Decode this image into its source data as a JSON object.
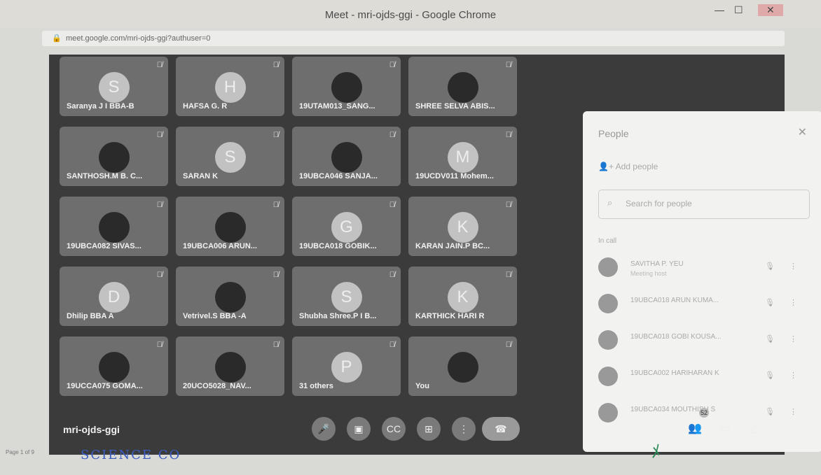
{
  "window": {
    "title": "Meet - mri-ojds-ggi - Google Chrome",
    "url": "meet.google.com/mri-ojds-ggi?authuser=0"
  },
  "tiles": [
    {
      "name": "Saranya J I BBA-B",
      "initial": "S"
    },
    {
      "name": "HAFSA G. R",
      "initial": "H"
    },
    {
      "name": "19UTAM013_SANG...",
      "initial": ""
    },
    {
      "name": "SHREE SELVA ABIS...",
      "initial": ""
    },
    {
      "name": "SANTHOSH.M B. C...",
      "initial": ""
    },
    {
      "name": "SARAN K",
      "initial": "S"
    },
    {
      "name": "19UBCA046 SANJA...",
      "initial": ""
    },
    {
      "name": "19UCDV011 Mohem...",
      "initial": "M"
    },
    {
      "name": "19UBCA082 SIVAS...",
      "initial": ""
    },
    {
      "name": "19UBCA006 ARUN...",
      "initial": ""
    },
    {
      "name": "19UBCA018 GOBIK...",
      "initial": "G"
    },
    {
      "name": "KARAN JAIN.P BC...",
      "initial": "K"
    },
    {
      "name": "Dhilip BBA A",
      "initial": "D"
    },
    {
      "name": "Vetrivel.S BBA -A",
      "initial": ""
    },
    {
      "name": "Shubha Shree.P I B...",
      "initial": "S"
    },
    {
      "name": "KARTHICK HARI R",
      "initial": "K"
    },
    {
      "name": "19UCCA075 GOMA...",
      "initial": ""
    },
    {
      "name": "20UCO5028_NAV...",
      "initial": ""
    },
    {
      "name": "31 others",
      "initial": "P"
    },
    {
      "name": "You",
      "initial": ""
    }
  ],
  "people": {
    "title": "People",
    "add": "Add people",
    "search_placeholder": "Search for people",
    "in_call": "In call",
    "rows": [
      {
        "name": "SAVITHA P. YEU",
        "sub": "Meeting host"
      },
      {
        "name": "19UBCA018 ARUN KUMA...",
        "sub": ""
      },
      {
        "name": "19UBCA018 GOBI KOUSA...",
        "sub": ""
      },
      {
        "name": "19UBCA002 HARIHARAN K",
        "sub": ""
      },
      {
        "name": "19UBCA034 MOUTHISH S",
        "sub": ""
      }
    ]
  },
  "meeting_code": "mri-ojds-ggi",
  "participants_badge": "52",
  "stamp_text": "SCIENCE CO",
  "page_label": "Page 1 of 9"
}
